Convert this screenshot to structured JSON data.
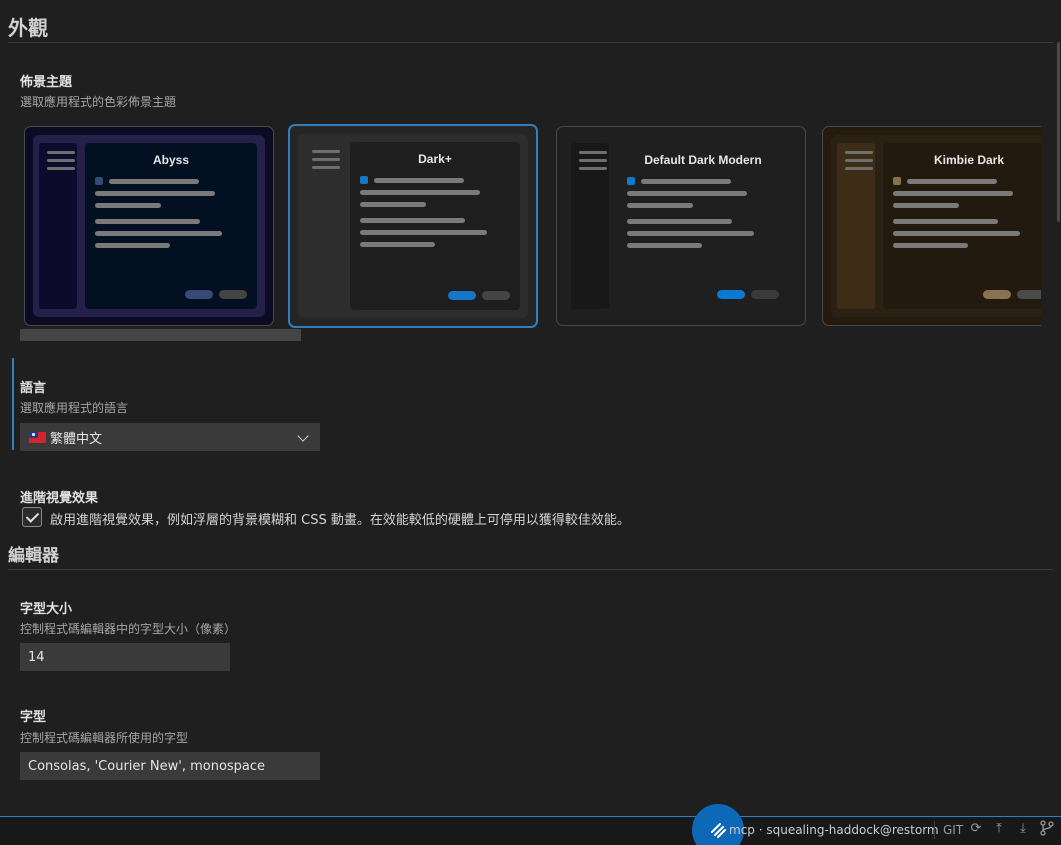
{
  "appearance": {
    "title": "外觀",
    "theme": {
      "label": "佈景主題",
      "description": "選取應用程式的色彩佈景主題",
      "cards": [
        {
          "name": "Abyss",
          "selected": false,
          "colors": {
            "outer": "#0c0b24",
            "frame": "#24204a",
            "side": "#0c0b2b",
            "main": "#031021",
            "accent": "#384a76",
            "pill1": "#384a76",
            "pill2": "#444444"
          }
        },
        {
          "name": "Dark+",
          "selected": true,
          "colors": {
            "outer": "#252526",
            "frame": "#2d2d2d",
            "side": "#2d2d2d",
            "main": "#1e1e1e",
            "accent": "#1676c8",
            "pill1": "#1676c8",
            "pill2": "#444444"
          }
        },
        {
          "name": "Default Dark Modern",
          "selected": false,
          "colors": {
            "outer": "#1f1f1f",
            "frame": "#1f1f1f",
            "side": "#181818",
            "main": "#1f1f1f",
            "accent": "#0c7ad0",
            "pill1": "#0c7ad0",
            "pill2": "#3a3a3a"
          }
        },
        {
          "name": "Kimbie Dark",
          "selected": false,
          "colors": {
            "outer": "#241a0e",
            "frame": "#2a2114",
            "side": "#3e2d16",
            "main": "#221a0f",
            "accent": "#8a7152",
            "pill1": "#8a7152",
            "pill2": "#4a4a4a"
          }
        }
      ]
    },
    "language": {
      "label": "語言",
      "description": "選取應用程式的語言",
      "value": "繁體中文"
    },
    "visual_effects": {
      "label": "進階視覺效果",
      "checkbox_text": "啟用進階視覺效果，例如浮層的背景模糊和 CSS 動畫。在效能較低的硬體上可停用以獲得較佳效能。",
      "checked": true
    }
  },
  "editor": {
    "title": "編輯器",
    "font_size": {
      "label": "字型大小",
      "description": "控制程式碼編輯器中的字型大小（像素）",
      "value": "14"
    },
    "font_family": {
      "label": "字型",
      "description": "控制程式碼編輯器所使用的字型",
      "value": "Consolas, 'Courier New', monospace"
    }
  },
  "status_bar": {
    "text": "mcp · squealing-haddock@restorm",
    "git_label": "GIT",
    "accent_color": "#2f7fc1"
  }
}
